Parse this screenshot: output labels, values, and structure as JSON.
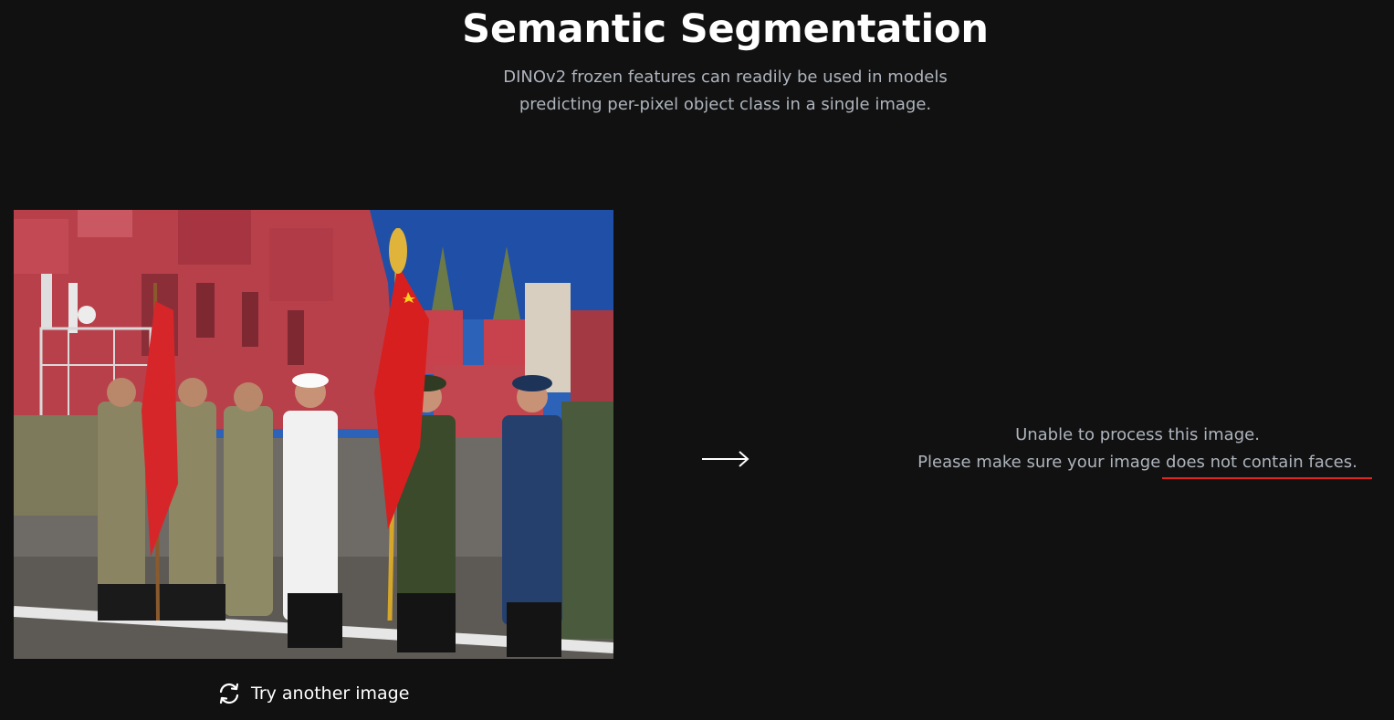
{
  "header": {
    "title": "Semantic Segmentation",
    "subtitle_line1": "DINOv2 frozen features can readily be used in models",
    "subtitle_line2": "predicting per-pixel object class in a single image."
  },
  "input_image": {
    "alt": "Soldiers in various uniforms standing with red flags in front of a red brick building"
  },
  "actions": {
    "try_again_label": "Try another image",
    "try_again_icon": "refresh-icon"
  },
  "result": {
    "arrow_icon": "arrow-right-icon",
    "error_line1": "Unable to process this image.",
    "error_line2": "Please make sure your image does not contain faces."
  },
  "colors": {
    "background": "#111111",
    "text_muted": "#aeb4bd",
    "accent_underline": "#e0241f"
  }
}
